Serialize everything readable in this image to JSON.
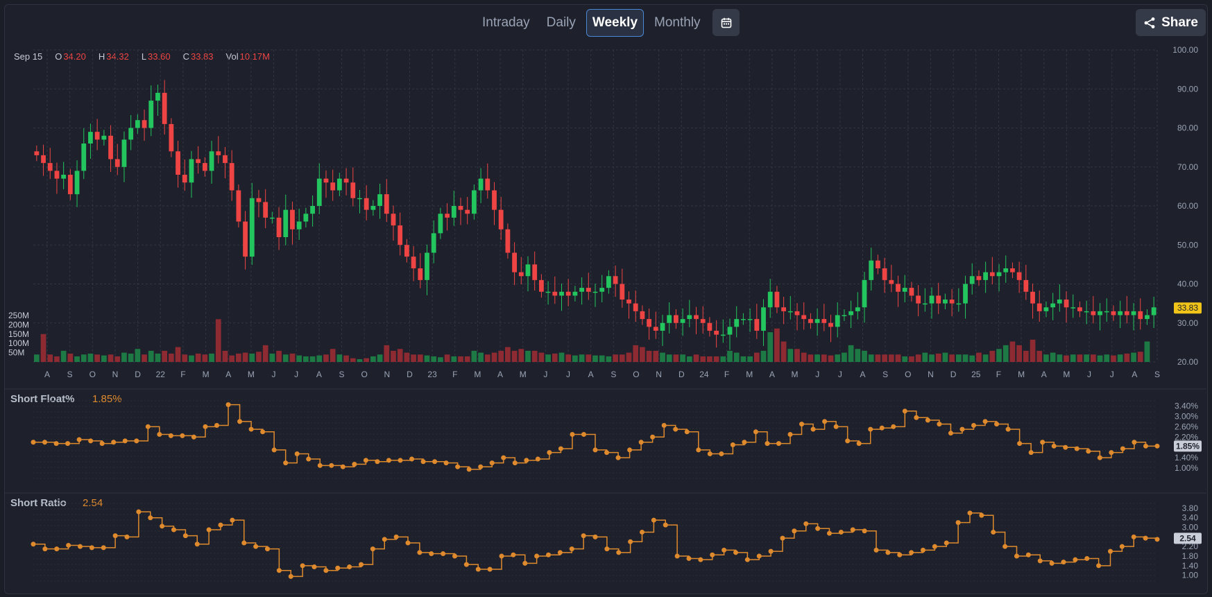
{
  "tabs": [
    "Intraday",
    "Daily",
    "Weekly",
    "Monthly"
  ],
  "active_tab": "Weekly",
  "share_label": "Share",
  "ohlc": {
    "date": "Sep 15",
    "o_label": "O",
    "o": "34.20",
    "h_label": "H",
    "h": "34.32",
    "l_label": "L",
    "l": "33.60",
    "c_label": "C",
    "c": "33.83",
    "vol_label": "Vol",
    "vol": "10.17M"
  },
  "colors": {
    "up": "#22c55e",
    "down": "#ef4444",
    "vol_up": "#1e7a45",
    "vol_down": "#8e2a32",
    "line": "#e08a2e",
    "last_price": "#f0c419",
    "grid": "#303644"
  },
  "chart_data": [
    {
      "type": "candlestick",
      "title": "",
      "ylim": [
        20,
        100
      ],
      "y_ticks": [
        "100.00",
        "90.00",
        "80.00",
        "70.00",
        "60.00",
        "50.00",
        "40.00",
        "30.00",
        "20.00"
      ],
      "x_ticks": [
        "A",
        "S",
        "O",
        "N",
        "D",
        "22",
        "F",
        "M",
        "A",
        "M",
        "J",
        "J",
        "A",
        "S",
        "O",
        "N",
        "D",
        "23",
        "F",
        "M",
        "A",
        "M",
        "J",
        "J",
        "A",
        "S",
        "O",
        "N",
        "D",
        "24",
        "F",
        "M",
        "A",
        "M",
        "J",
        "J",
        "A",
        "S",
        "O",
        "N",
        "D",
        "25",
        "F",
        "M",
        "A",
        "M",
        "J",
        "J",
        "A",
        "S"
      ],
      "last_price_label": "33.83",
      "candles_close": [
        73,
        71,
        69,
        67,
        68,
        63,
        69,
        76,
        79,
        77,
        78,
        72,
        70,
        77,
        80,
        82,
        80,
        87,
        89,
        81,
        74,
        68,
        66,
        72,
        71,
        69,
        74,
        73,
        71,
        64,
        56,
        47,
        62,
        61,
        57,
        57,
        52,
        59,
        54,
        56,
        58,
        60,
        67,
        66,
        64,
        67,
        66,
        62,
        62,
        59,
        60,
        63,
        58,
        55,
        50,
        47,
        44,
        41,
        48,
        53,
        58,
        57,
        60,
        59,
        58,
        64,
        67,
        64,
        59,
        54,
        48,
        43,
        42,
        45,
        41,
        38,
        38,
        37,
        38,
        37,
        38,
        39,
        38,
        38,
        39,
        42,
        40,
        36,
        35,
        33,
        31,
        29,
        28,
        30,
        32,
        30,
        31,
        32,
        31,
        30,
        28,
        27,
        27,
        29,
        31,
        31,
        31,
        28,
        34,
        38,
        34,
        33,
        33,
        32,
        31,
        30,
        31,
        30,
        29,
        32,
        32,
        33,
        34,
        41,
        46,
        44,
        41,
        40,
        38,
        39,
        37,
        35,
        35,
        37,
        35,
        36,
        35,
        35,
        40,
        42,
        41,
        43,
        42,
        43,
        44,
        43,
        41,
        38,
        35,
        33,
        34,
        35,
        36,
        34,
        34,
        33,
        33,
        32,
        33,
        33,
        32,
        33,
        32,
        33,
        31,
        32,
        34
      ],
      "volume_axis": [
        "250M",
        "200M",
        "150M",
        "100M",
        "50M"
      ],
      "volumes": [
        40,
        150,
        40,
        30,
        60,
        45,
        30,
        40,
        45,
        40,
        35,
        40,
        30,
        50,
        45,
        70,
        40,
        60,
        45,
        60,
        45,
        80,
        40,
        35,
        45,
        40,
        45,
        230,
        60,
        35,
        45,
        50,
        45,
        55,
        90,
        45,
        60,
        40,
        45,
        35,
        30,
        30,
        35,
        40,
        70,
        40,
        35,
        20,
        15,
        20,
        30,
        40,
        90,
        60,
        70,
        50,
        40,
        40,
        35,
        30,
        25,
        40,
        30,
        30,
        30,
        60,
        50,
        40,
        50,
        60,
        80,
        60,
        70,
        60,
        60,
        50,
        40,
        45,
        50,
        40,
        35,
        40,
        40,
        35,
        35,
        30,
        40,
        40,
        50,
        90,
        80,
        60,
        60,
        50,
        40,
        40,
        40,
        30,
        40,
        30,
        30,
        30,
        30,
        60,
        50,
        30,
        30,
        50,
        60,
        160,
        180,
        110,
        70,
        70,
        50,
        40,
        40,
        40,
        35,
        40,
        50,
        90,
        70,
        60,
        40,
        40,
        40,
        40,
        40,
        30,
        30,
        40,
        50,
        40,
        45,
        50,
        40,
        40,
        40,
        35,
        50,
        40,
        60,
        70,
        90,
        110,
        90,
        60,
        120,
        60,
        40,
        50,
        40,
        35,
        40,
        40,
        40,
        40,
        35,
        40,
        35,
        40,
        45,
        50,
        55,
        110
      ],
      "vol_ylim": [
        0,
        250
      ]
    },
    {
      "type": "line",
      "title": "Short Float%",
      "current_value": "1.85%",
      "y_ticks": [
        "3.40%",
        "3.00%",
        "2.60%",
        "2.20%",
        "1.85%",
        "1.40%",
        "1.00%"
      ],
      "ylim": [
        0.6,
        3.6
      ],
      "values": [
        2.0,
        2.0,
        1.95,
        1.95,
        2.1,
        2.05,
        1.95,
        2.0,
        2.05,
        2.05,
        2.6,
        2.3,
        2.25,
        2.25,
        2.2,
        2.6,
        2.65,
        3.45,
        2.8,
        2.5,
        2.4,
        1.7,
        1.2,
        1.55,
        1.35,
        1.1,
        1.1,
        1.05,
        1.15,
        1.3,
        1.25,
        1.3,
        1.3,
        1.35,
        1.25,
        1.25,
        1.2,
        1.05,
        0.95,
        1.05,
        1.2,
        1.4,
        1.2,
        1.3,
        1.35,
        1.6,
        1.75,
        2.3,
        2.3,
        1.7,
        1.6,
        1.4,
        1.7,
        2.0,
        2.2,
        2.65,
        2.5,
        2.4,
        1.7,
        1.55,
        1.55,
        1.9,
        2.0,
        2.4,
        1.95,
        1.95,
        2.3,
        2.7,
        2.5,
        2.8,
        2.6,
        2.05,
        1.95,
        2.5,
        2.55,
        2.6,
        3.2,
        2.95,
        2.85,
        2.7,
        2.35,
        2.5,
        2.65,
        2.8,
        2.7,
        2.5,
        1.95,
        1.6,
        2.0,
        1.85,
        1.8,
        1.75,
        1.65,
        1.4,
        1.6,
        1.75,
        2.0,
        1.85,
        1.85
      ]
    },
    {
      "type": "line",
      "title": "Short Ratio",
      "current_value": "2.54",
      "y_ticks": [
        "3.80",
        "3.40",
        "3.00",
        "2.60",
        "2.54",
        "2.20",
        "1.80",
        "1.40",
        "1.00"
      ],
      "ylim": [
        0.7,
        4.0
      ],
      "values": [
        2.3,
        2.1,
        2.1,
        2.25,
        2.2,
        2.15,
        2.15,
        2.65,
        2.6,
        3.65,
        3.4,
        3.05,
        2.9,
        2.65,
        2.3,
        2.9,
        3.1,
        3.3,
        2.35,
        2.2,
        2.1,
        1.2,
        0.95,
        1.4,
        1.35,
        1.2,
        1.3,
        1.35,
        1.45,
        2.1,
        2.5,
        2.6,
        2.35,
        1.95,
        1.9,
        1.9,
        1.8,
        1.45,
        1.25,
        1.25,
        1.8,
        1.85,
        1.5,
        1.8,
        1.85,
        1.95,
        2.1,
        2.65,
        2.6,
        2.1,
        1.95,
        2.4,
        2.8,
        3.3,
        3.1,
        1.8,
        1.7,
        1.65,
        1.85,
        2.05,
        1.95,
        1.65,
        1.8,
        2.0,
        2.55,
        2.85,
        3.15,
        2.95,
        2.75,
        2.8,
        2.9,
        2.85,
        2.05,
        1.95,
        1.85,
        1.95,
        2.05,
        2.2,
        2.35,
        3.2,
        3.6,
        3.5,
        2.8,
        2.2,
        1.8,
        1.85,
        1.6,
        1.5,
        1.55,
        1.65,
        1.7,
        1.4,
        2.0,
        2.2,
        2.6,
        2.55,
        2.5
      ]
    }
  ]
}
